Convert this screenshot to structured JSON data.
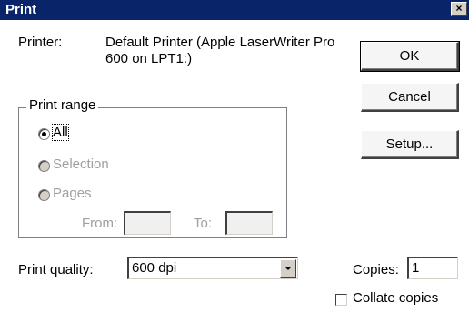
{
  "window": {
    "title": "Print",
    "close_glyph": "×"
  },
  "printer": {
    "label": "Printer:",
    "name_line1": "Default Printer (Apple LaserWriter Pro",
    "name_line2": "600 on LPT1:)"
  },
  "buttons": {
    "ok": "OK",
    "cancel": "Cancel",
    "setup": "Setup..."
  },
  "print_range": {
    "legend": "Print range",
    "all": "All",
    "selection": "Selection",
    "pages": "Pages",
    "selected": "all",
    "from_label": "From:",
    "to_label": "To:",
    "from_value": "",
    "to_value": ""
  },
  "quality": {
    "label": "Print quality:",
    "value": "600 dpi"
  },
  "copies": {
    "label": "Copies:",
    "value": "1",
    "collate_label": "Collate copies",
    "collate_checked": false
  },
  "icons": {
    "close": "close-icon",
    "dropdown": "chevron-down-icon"
  }
}
